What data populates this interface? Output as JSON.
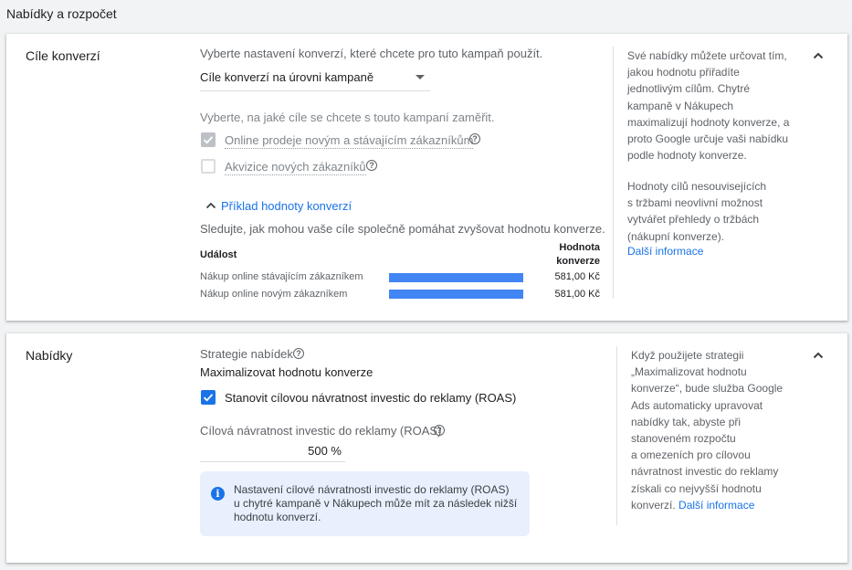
{
  "page": {
    "title": "Nabídky a rozpočet"
  },
  "conversion": {
    "section_title": "Cíle konverzí",
    "select_prompt": "Vyberte nastavení konverzí, které chcete pro tuto kampaň použít.",
    "dropdown_value": "Cíle konverzí na úrovni kampaně",
    "goals_prompt": "Vyberte, na jaké cíle se chcete s touto kampaní zaměřit.",
    "goals": [
      {
        "label": "Online prodeje novým a stávajícím zákazníkům",
        "checked": true,
        "disabled": true
      },
      {
        "label": "Akvizice nových zákazníků",
        "checked": false,
        "disabled": true
      }
    ],
    "example_link": "Příklad hodnoty konverzí",
    "example_desc": "Sledujte, jak mohou vaše cíle společně pomáhat zvyšovat hodnotu konverze.",
    "table": {
      "col_event": "Událost",
      "col_value_line1": "Hodnota",
      "col_value_line2": "konverze",
      "rows": [
        {
          "event": "Nákup online stávajícím zákazníkem",
          "value": "581,00 Kč",
          "fraction": 1.0
        },
        {
          "event": "Nákup online novým zákazníkem",
          "value": "581,00 Kč",
          "fraction": 1.0
        }
      ]
    },
    "side_text_1": "Své nabídky můžete určovat tím,\njakou hodnotu přiřadíte\njednotlivým cílům. Chytré\nkampaně v Nákupech\nmaximalizují hodnoty konverze, a\nproto Google určuje vaši nabídku\npodle hodnoty konverze.",
    "side_text_2": "Hodnoty cílů nesouvisejících\ns tržbami neovlivní možnost\nvytvářet přehledy o tržbách\n(nákupní konverze).",
    "side_link": "Další informace"
  },
  "bids": {
    "section_title": "Nabídky",
    "strategy_label": "Strategie nabídek",
    "strategy_value": "Maximalizovat hodnotu konverze",
    "roas_checkbox_label": "Stanovit cílovou návratnost investic do reklamy (ROAS)",
    "roas_checked": true,
    "roas_field_label": "Cílová návratnost investic do reklamy (ROAS)",
    "roas_value": "500 %",
    "info_text": "Nastavení cílové návratnosti investic do reklamy (ROAS)\nu chytré kampaně v Nákupech může mít za následek nižší\nhodnotu konverzí.",
    "side_text": "Když použijete strategii\n„Maximalizovat hodnotu\nkonverze“, bude služba Google\nAds automaticky upravovat\nnabídky tak, abyste při\nstanoveném rozpočtu\na omezeních pro cílovou\nnávratnost investic do reklamy\nzískali co nejvyšší hodnotu\nkonverzí. ",
    "side_link": "Další informace"
  },
  "colors": {
    "accent": "#1a73e8",
    "bar": "#4285f4",
    "info_bg": "#e8f0fe"
  },
  "icons": [
    "help-icon",
    "chevron-up-icon",
    "dropdown-caret-icon",
    "checkmark-icon",
    "info-icon"
  ]
}
